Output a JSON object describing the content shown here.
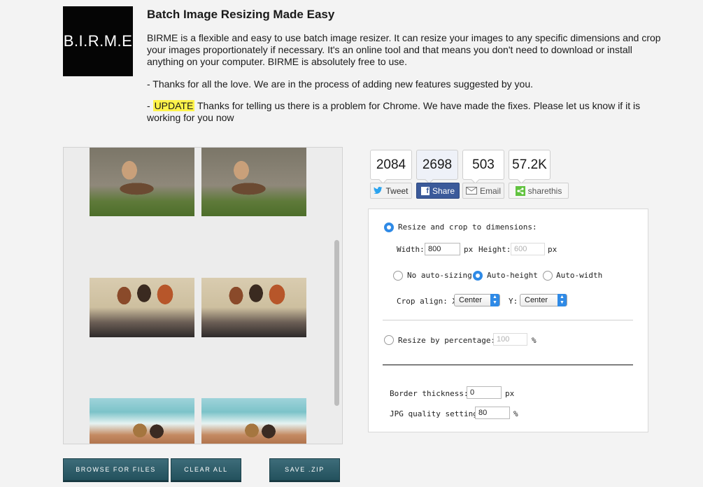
{
  "logo_text": "B.I.R.M.E",
  "headline": "Batch Image Resizing Made Easy",
  "intro": {
    "p1": "BIRME is a flexible and easy to use batch image resizer. It can resize your images to any specific dimensions and crop your images proportionately if necessary. It's an online tool and that means you don't need to download or install anything on your computer. BIRME is absolutely free to use.",
    "p2": "- Thanks for all the love. We are in the process of adding new features suggested by you.",
    "p3_prefix": "- ",
    "p3_highlight": "UPDATE",
    "p3_rest": " Thanks for telling us there is a problem for Chrome. We have made the fixes. Please let us know if it is working for you now"
  },
  "buttons": {
    "browse": "BROWSE FOR FILES",
    "clear": "CLEAR ALL",
    "save": "SAVE .ZIP"
  },
  "share": {
    "tweet": {
      "count": "2084",
      "label": "Tweet",
      "color": "#2aa3ef"
    },
    "facebook": {
      "count": "2698",
      "label": "Share",
      "color": "#3b5a9a"
    },
    "email": {
      "count": "503",
      "label": "Email"
    },
    "sharethis": {
      "count": "57.2K",
      "label": "sharethis",
      "color": "#62c340"
    }
  },
  "settings": {
    "resize_crop_label": "Resize and crop to dimensions:",
    "width_label": "Width:",
    "width_value": "800",
    "width_unit": "px",
    "height_label": "Height:",
    "height_value": "600",
    "height_unit": "px",
    "no_auto_label": "No auto-sizing",
    "auto_height_label": "Auto-height",
    "auto_width_label": "Auto-width",
    "crop_align_label": "Crop align: X:",
    "crop_x_value": "Center",
    "crop_y_label": "Y:",
    "crop_y_value": "Center",
    "percent_label": "Resize by percentage:",
    "percent_value": "100",
    "percent_unit": "%",
    "border_label": "Border thickness:",
    "border_value": "0",
    "border_unit": "px",
    "jpg_label": "JPG quality setting:",
    "jpg_value": "80",
    "jpg_unit": "%"
  },
  "accent_color": "#2f8ae6",
  "button_color": "#2f5f6b"
}
